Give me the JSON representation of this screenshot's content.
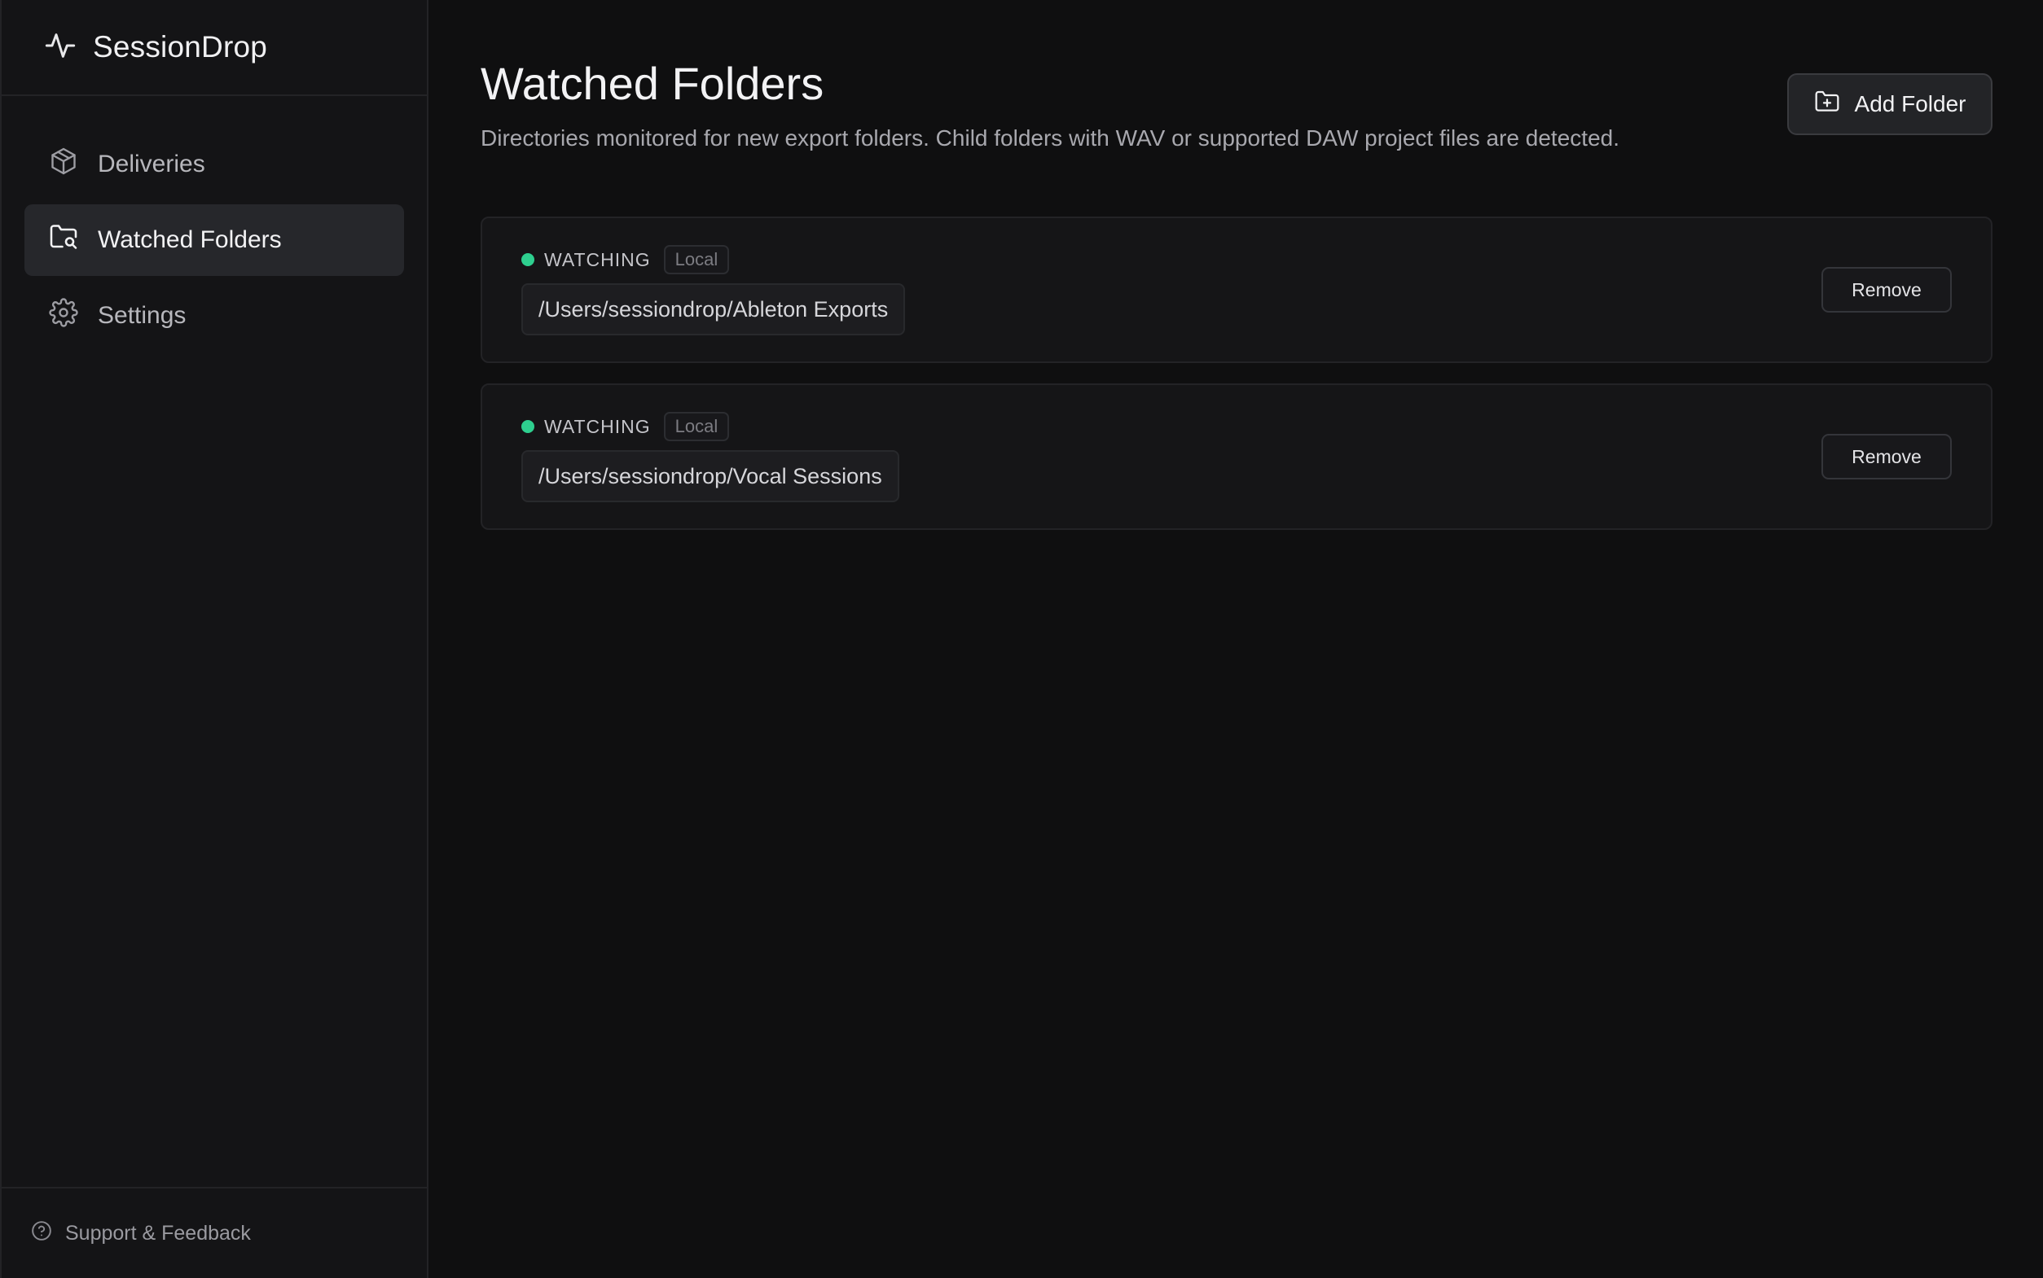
{
  "app": {
    "name": "SessionDrop",
    "logo_icon": "activity-pulse-icon"
  },
  "sidebar": {
    "items": [
      {
        "label": "Deliveries",
        "icon": "package-icon",
        "active": false
      },
      {
        "label": "Watched Folders",
        "icon": "folder-search-icon",
        "active": true
      },
      {
        "label": "Settings",
        "icon": "gear-icon",
        "active": false
      }
    ],
    "footer": {
      "label": "Support & Feedback",
      "icon": "help-circle-icon"
    }
  },
  "main": {
    "title": "Watched Folders",
    "description": "Directories monitored for new export folders. Child folders with WAV or supported DAW project files are detected.",
    "add_button": {
      "label": "Add Folder",
      "icon": "folder-plus-icon"
    },
    "folders": [
      {
        "status": "WATCHING",
        "tag": "Local",
        "path": "/Users/sessiondrop/Ableton Exports",
        "remove_label": "Remove"
      },
      {
        "status": "WATCHING",
        "tag": "Local",
        "path": "/Users/sessiondrop/Vocal Sessions",
        "remove_label": "Remove"
      }
    ]
  },
  "colors": {
    "background": "#0f0f10",
    "sidebar": "#141416",
    "active_nav": "#26272b",
    "status_green": "#2ecf8f"
  }
}
